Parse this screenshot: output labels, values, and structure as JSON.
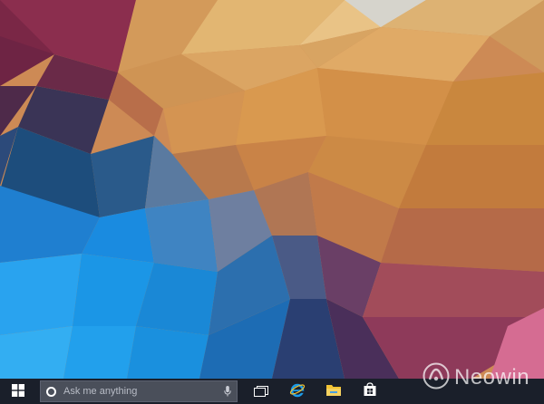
{
  "desktop": {
    "wallpaper": "low-poly geometric wallpaper",
    "colors": {
      "blue": "#1e90e0",
      "orange": "#d99a52",
      "magenta": "#b23a5e"
    }
  },
  "taskbar": {
    "background": "#1a1f2a",
    "start_icon": "windows-logo-icon",
    "search": {
      "placeholder": "Ask me anything",
      "left_icon": "cortana-circle-icon",
      "right_icon": "microphone-icon"
    },
    "pinned": [
      {
        "icon": "task-view-icon"
      },
      {
        "icon": "internet-explorer-icon",
        "color": "#1c9be8"
      },
      {
        "icon": "file-explorer-folder-icon",
        "color": "#f2c434"
      },
      {
        "icon": "store-bag-icon"
      }
    ]
  },
  "watermark": {
    "text": "Neowin"
  }
}
